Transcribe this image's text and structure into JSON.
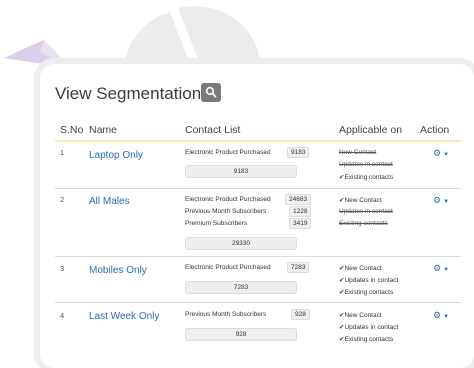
{
  "page": {
    "title": "View Segmentation",
    "colors": {
      "link": "#2a6fb0",
      "header_rule": "#f7e9b0",
      "search_button": "#7a7a7a"
    }
  },
  "table": {
    "headers": {
      "sno": "S.No",
      "name": "Name",
      "contact_list": "Contact List",
      "applicable_on": "Applicable on",
      "action": "Action"
    },
    "rows": [
      {
        "sno": "1",
        "name": "Laptop Only",
        "lists": [
          {
            "label": "Electronic Product Purchased",
            "count": "9183"
          }
        ],
        "total": "9183",
        "applicable": [
          {
            "label": "New Contact",
            "enabled": false
          },
          {
            "label": "Updates in contact",
            "enabled": false
          },
          {
            "label": "Existing contacts",
            "enabled": true
          }
        ]
      },
      {
        "sno": "2",
        "name": "All Males",
        "lists": [
          {
            "label": "Electronic Product Purchased",
            "count": "24683"
          },
          {
            "label": "Previous Month Subscribers",
            "count": "1228"
          },
          {
            "label": "Premium Subscribers",
            "count": "3419"
          }
        ],
        "total": "29330",
        "applicable": [
          {
            "label": "New Contact",
            "enabled": true
          },
          {
            "label": "Updates in contact",
            "enabled": false
          },
          {
            "label": "Existing contacts",
            "enabled": false
          }
        ]
      },
      {
        "sno": "3",
        "name": "Mobiles Only",
        "lists": [
          {
            "label": "Electronic Product Purchased",
            "count": "7283"
          }
        ],
        "total": "7283",
        "applicable": [
          {
            "label": "New Contact",
            "enabled": true
          },
          {
            "label": "Updates in contact",
            "enabled": true
          },
          {
            "label": "Existing contacts",
            "enabled": true
          }
        ]
      },
      {
        "sno": "4",
        "name": "Last Week Only",
        "lists": [
          {
            "label": "Previous Month Subscribers",
            "count": "928"
          }
        ],
        "total": "928",
        "applicable": [
          {
            "label": "New Contact",
            "enabled": true
          },
          {
            "label": "Updates in contact",
            "enabled": true
          },
          {
            "label": "Existing contacts",
            "enabled": true
          }
        ]
      }
    ],
    "action_icons": {
      "action": "gear-icon",
      "menu": "caret-down-icon"
    }
  }
}
